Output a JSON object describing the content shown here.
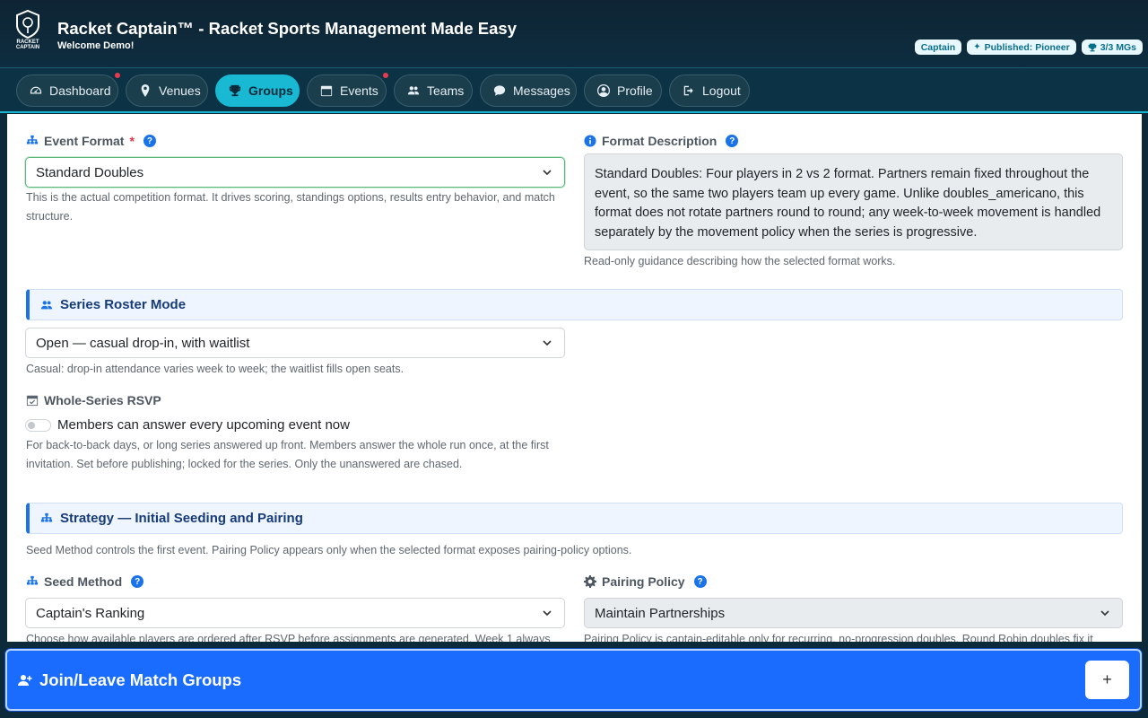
{
  "header": {
    "title": "Racket Captain™ - Racket Sports Management Made Easy",
    "welcome": "Welcome Demo!",
    "logo_text": "RACKET CAPTAIN",
    "badges": [
      "Captain",
      "Published: Pioneer",
      "3/3 MGs"
    ]
  },
  "nav": {
    "items": [
      {
        "label": "Dashboard",
        "icon": "gauge-icon",
        "notification": true
      },
      {
        "label": "Venues",
        "icon": "map-pin-icon",
        "notification": false
      },
      {
        "label": "Groups",
        "icon": "trophy-icon",
        "notification": false,
        "active": true
      },
      {
        "label": "Events",
        "icon": "calendar-icon",
        "notification": true
      },
      {
        "label": "Teams",
        "icon": "people-icon",
        "notification": false
      },
      {
        "label": "Messages",
        "icon": "chat-icon",
        "notification": false
      },
      {
        "label": "Profile",
        "icon": "user-circle-icon",
        "notification": false
      },
      {
        "label": "Logout",
        "icon": "logout-icon",
        "notification": false
      }
    ]
  },
  "form": {
    "event_format": {
      "label": "Event Format",
      "required": "*",
      "value": "Standard Doubles",
      "hint": "This is the actual competition format. It drives scoring, standings options, results entry behavior, and match structure."
    },
    "format_description": {
      "label": "Format Description",
      "text": "Standard Doubles: Four players in 2 vs 2 format. Partners remain fixed throughout the event, so the same two players team up every game. Unlike doubles_americano, this format does not rotate partners round to round; any week-to-week movement is handled separately by the movement policy when the series is progressive.",
      "hint": "Read-only guidance describing how the selected format works."
    },
    "series_roster": {
      "title": "Series Roster Mode",
      "value": "Open — casual drop-in, with waitlist",
      "hint": "Casual: drop-in attendance varies week to week; the waitlist fills open seats."
    },
    "rsvp": {
      "label": "Whole-Series RSVP",
      "toggle_label": "Members can answer every upcoming event now",
      "toggle_on": false,
      "hint": "For back-to-back days, or long series answered up front. Members answer the whole run once, at the first invitation. Set before publishing; locked for the series. Only the unanswered are chased."
    },
    "strategy": {
      "title": "Strategy — Initial Seeding and Pairing",
      "hint": "Seed Method controls the first event. Pairing Policy appears only when the selected format exposes pairing-policy options."
    },
    "seed_method": {
      "label": "Seed Method",
      "value": "Captain's Ranking",
      "hint": "Choose how available players are ordered after RSVP before assignments are generated. Week 1 always"
    },
    "pairing_policy": {
      "label": "Pairing Policy",
      "value": "Maintain Partnerships",
      "hint": "Pairing Policy is captain-editable only for recurring, no-progression doubles. Round Robin doubles fix it"
    }
  },
  "bottom": {
    "title": "Join/Leave Match Groups",
    "button": "+"
  },
  "colors": {
    "header_bg": "#0e2433",
    "nav_active": "#19b9d4",
    "accent_blue": "#1a6cff",
    "notification_dot": "#e8394f"
  }
}
